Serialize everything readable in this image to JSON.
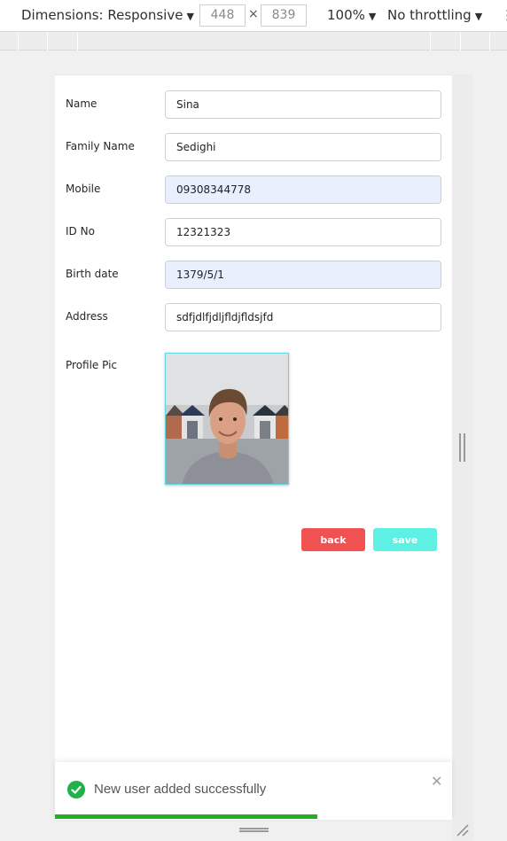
{
  "devtools": {
    "dimensions_label": "Dimensions: Responsive",
    "width": "448",
    "times": "×",
    "height": "839",
    "zoom": "100%",
    "throttling": "No throttling"
  },
  "form": {
    "fields": [
      {
        "label": "Name",
        "value": "Sina"
      },
      {
        "label": "Family Name",
        "value": "Sedighi"
      },
      {
        "label": "Mobile",
        "value": "09308344778"
      },
      {
        "label": "ID No",
        "value": "12321323"
      },
      {
        "label": "Birth date",
        "value": "1379/5/1"
      },
      {
        "label": "Address",
        "value": "sdfjdlfjdljfldjfldsjfd"
      }
    ],
    "profile_pic_label": "Profile Pic",
    "back_label": "back",
    "save_label": "save"
  },
  "toast": {
    "message": "New user added successfully",
    "close_glyph": "✕",
    "progress": 0.66,
    "color": "#22b022"
  },
  "colors": {
    "back": "#f05252",
    "save": "#5ef0e2",
    "autofill": "#e8f0fe"
  }
}
